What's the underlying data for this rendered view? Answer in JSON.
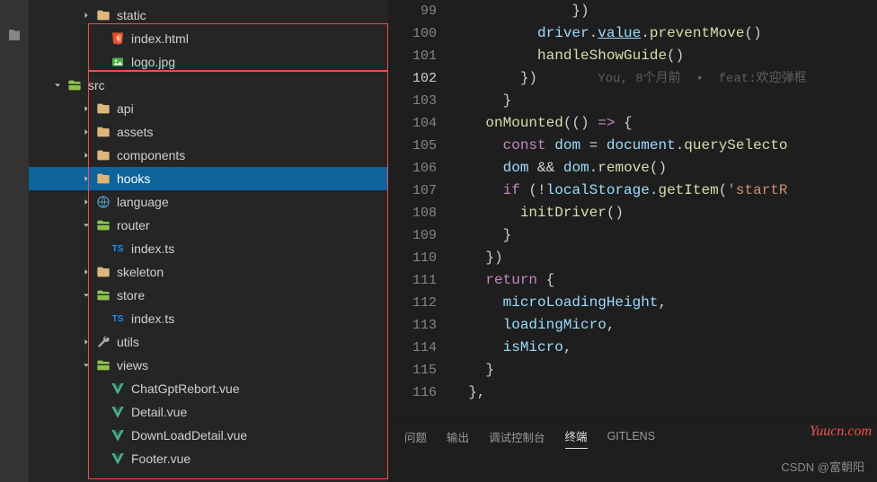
{
  "sidebar": {
    "items": [
      {
        "label": "static",
        "icon": "folder",
        "indent": 3,
        "twistie": "right"
      },
      {
        "label": "index.html",
        "icon": "html",
        "indent": 4,
        "twistie": "none"
      },
      {
        "label": "logo.jpg",
        "icon": "image",
        "indent": 4,
        "twistie": "none"
      },
      {
        "label": "src",
        "icon": "folder-green",
        "indent": 1,
        "twistie": "down"
      },
      {
        "label": "api",
        "icon": "folder",
        "indent": 3,
        "twistie": "right"
      },
      {
        "label": "assets",
        "icon": "folder",
        "indent": 3,
        "twistie": "right"
      },
      {
        "label": "components",
        "icon": "folder",
        "indent": 3,
        "twistie": "right"
      },
      {
        "label": "hooks",
        "icon": "folder",
        "indent": 3,
        "twistie": "right",
        "selected": true
      },
      {
        "label": "language",
        "icon": "lang",
        "indent": 3,
        "twistie": "right"
      },
      {
        "label": "router",
        "icon": "folder-green",
        "indent": 3,
        "twistie": "down"
      },
      {
        "label": "index.ts",
        "icon": "ts",
        "indent": 4,
        "twistie": "none"
      },
      {
        "label": "skeleton",
        "icon": "folder",
        "indent": 3,
        "twistie": "right"
      },
      {
        "label": "store",
        "icon": "folder-green",
        "indent": 3,
        "twistie": "down"
      },
      {
        "label": "index.ts",
        "icon": "ts",
        "indent": 4,
        "twistie": "none"
      },
      {
        "label": "utils",
        "icon": "wrench",
        "indent": 3,
        "twistie": "right"
      },
      {
        "label": "views",
        "icon": "folder-green",
        "indent": 3,
        "twistie": "down"
      },
      {
        "label": "ChatGptRebort.vue",
        "icon": "vue",
        "indent": 4,
        "twistie": "none"
      },
      {
        "label": "Detail.vue",
        "icon": "vue",
        "indent": 4,
        "twistie": "none"
      },
      {
        "label": "DownLoadDetail.vue",
        "icon": "vue",
        "indent": 4,
        "twistie": "none"
      },
      {
        "label": "Footer.vue",
        "icon": "vue",
        "indent": 4,
        "twistie": "none"
      }
    ]
  },
  "editor": {
    "codelens": "You, 8个月前  •  feat:欢迎弹框",
    "lines": [
      {
        "n": 99,
        "html": "              })"
      },
      {
        "n": 100,
        "html": "          <span class='tk-var'>driver</span><span class='tk-pn'>.</span><span class='tk-prop tk-underline'>value</span><span class='tk-pn'>.</span><span class='tk-fn'>preventMove</span><span class='tk-pn'>()</span>"
      },
      {
        "n": 101,
        "html": "          <span class='tk-fn'>handleShowGuide</span><span class='tk-pn'>()</span>"
      },
      {
        "n": 102,
        "html": "        <span class='tk-pn'>})</span>       <span class='codelens'>You, 8个月前  •  feat:欢迎弹框</span>",
        "current": true
      },
      {
        "n": 103,
        "html": "      <span class='tk-pn'>}</span>"
      },
      {
        "n": 104,
        "html": "    <span class='tk-fn'>onMounted</span><span class='tk-pn'>(() </span><span class='tk-kw'>=&gt;</span><span class='tk-pn'> {</span>"
      },
      {
        "n": 105,
        "html": "      <span class='tk-kw'>const</span> <span class='tk-var'>dom</span> <span class='tk-op'>=</span> <span class='tk-var'>document</span><span class='tk-pn'>.</span><span class='tk-fn'>querySelecto</span>"
      },
      {
        "n": 106,
        "html": "      <span class='tk-var'>dom</span> <span class='tk-op'>&amp;&amp;</span> <span class='tk-var'>dom</span><span class='tk-pn'>.</span><span class='tk-fn'>remove</span><span class='tk-pn'>()</span>"
      },
      {
        "n": 107,
        "html": "      <span class='tk-kw'>if</span> <span class='tk-pn'>(</span><span class='tk-op'>!</span><span class='tk-var'>localStorage</span><span class='tk-pn'>.</span><span class='tk-fn'>getItem</span><span class='tk-pn'>(</span><span class='tk-str'>'startR</span>"
      },
      {
        "n": 108,
        "html": "        <span class='tk-fn'>initDriver</span><span class='tk-pn'>()</span>"
      },
      {
        "n": 109,
        "html": "      <span class='tk-pn'>}</span>"
      },
      {
        "n": 110,
        "html": "    <span class='tk-pn'>})</span>"
      },
      {
        "n": 111,
        "html": "    <span class='tk-kw'>return</span> <span class='tk-pn'>{</span>"
      },
      {
        "n": 112,
        "html": "      <span class='tk-var'>microLoadingHeight</span><span class='tk-pn'>,</span>"
      },
      {
        "n": 113,
        "html": "      <span class='tk-var'>loadingMicro</span><span class='tk-pn'>,</span>"
      },
      {
        "n": 114,
        "html": "      <span class='tk-var'>isMicro</span><span class='tk-pn'>,</span>"
      },
      {
        "n": 115,
        "html": "    <span class='tk-pn'>}</span>"
      },
      {
        "n": 116,
        "html": "  <span class='tk-pn'>},</span>"
      }
    ]
  },
  "panel": {
    "tabs": [
      "问题",
      "输出",
      "调试控制台",
      "终端",
      "GITLENS"
    ],
    "active": "终端"
  },
  "watermarks": {
    "site": "Yuucn.com",
    "csdn": "CSDN @富朝阳"
  }
}
